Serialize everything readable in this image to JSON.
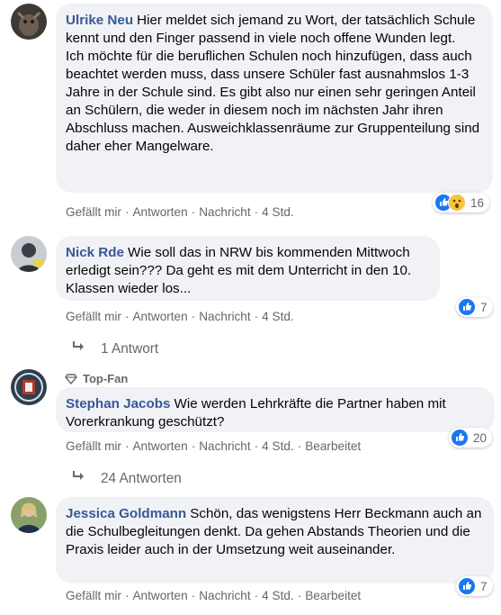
{
  "comments": [
    {
      "name": "Ulrike Neu",
      "text_first": "Hier meldet sich jemand zu Wort, der tatsächlich Schule kennt und den Finger passend in viele noch offene Wunden legt.",
      "text_second": "Ich möchte für die beruflichen Schulen noch hinzufügen, dass auch beachtet werden muss, dass unsere Schüler fast ausnahmslos 1-3 Jahre in der Schule sind. Es gibt also nur einen sehr geringen Anteil an Schülern, die weder in diesem noch im nächsten Jahr ihren Abschluss machen. Ausweichklassenräume zur Gruppenteilung sind daher eher Mangelware.",
      "like": "Gefällt mir",
      "reply": "Antworten",
      "message": "Nachricht",
      "time": "4 Std.",
      "reactions": "16",
      "reaction_icons": [
        "like-icon",
        "wow-icon"
      ]
    },
    {
      "name": "Nick Rde",
      "text": "Wie soll das in NRW bis kommenden Mittwoch erledigt sein??? Da geht es mit dem Unterricht in den 10. Klassen wieder los...",
      "like": "Gefällt mir",
      "reply": "Antworten",
      "message": "Nachricht",
      "time": "4 Std.",
      "reactions": "7",
      "replies": "1 Antwort"
    },
    {
      "badge": "Top-Fan",
      "name": "Stephan Jacobs",
      "text": "Wie werden Lehrkräfte die Partner haben mit Vorerkrankung geschützt?",
      "like": "Gefällt mir",
      "reply": "Antworten",
      "message": "Nachricht",
      "time": "4 Std.",
      "edited": "Bearbeitet",
      "reactions": "20",
      "replies": "24 Antworten"
    },
    {
      "name": "Jessica Goldmann",
      "text": "Schön, das wenigstens Herr Beckmann auch an die Schulbegleitungen denkt. Da gehen Abstands Theorien und die Praxis leider auch in der Umsetzung weit auseinander.",
      "like": "Gefällt mir",
      "reply": "Antworten",
      "message": "Nachricht",
      "time": "4 Std.",
      "edited": "Bearbeitet",
      "reactions": "7"
    }
  ],
  "colors": {
    "link": "#385898",
    "meta": "#65676b",
    "bubble": "#f0f2f5",
    "like": "#1877f2"
  }
}
